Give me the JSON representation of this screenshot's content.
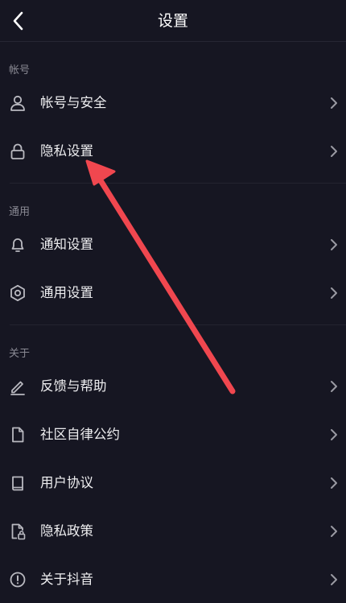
{
  "header": {
    "title": "设置"
  },
  "sections": {
    "account": {
      "label": "帐号",
      "items": [
        "帐号与安全",
        "隐私设置"
      ]
    },
    "general": {
      "label": "通用",
      "items": [
        "通知设置",
        "通用设置"
      ]
    },
    "about": {
      "label": "关于",
      "items": [
        "反馈与帮助",
        "社区自律公约",
        "用户协议",
        "隐私政策",
        "关于抖音"
      ]
    }
  },
  "icons": {
    "back": "chevron-left-icon",
    "account_security": "user-icon",
    "privacy": "lock-icon",
    "notifications": "bell-icon",
    "general_settings": "gear-icon",
    "feedback": "pencil-icon",
    "community": "document-icon",
    "agreement": "book-icon",
    "privacy_policy": "document-lock-icon",
    "about": "info-icon",
    "row_chevron": "chevron-right-icon"
  },
  "colors": {
    "background": "#161622",
    "text": "#eeeef0",
    "section_label": "#8a8a94",
    "icon": "#b9b9c0",
    "annotation_arrow": "#f0474f"
  }
}
